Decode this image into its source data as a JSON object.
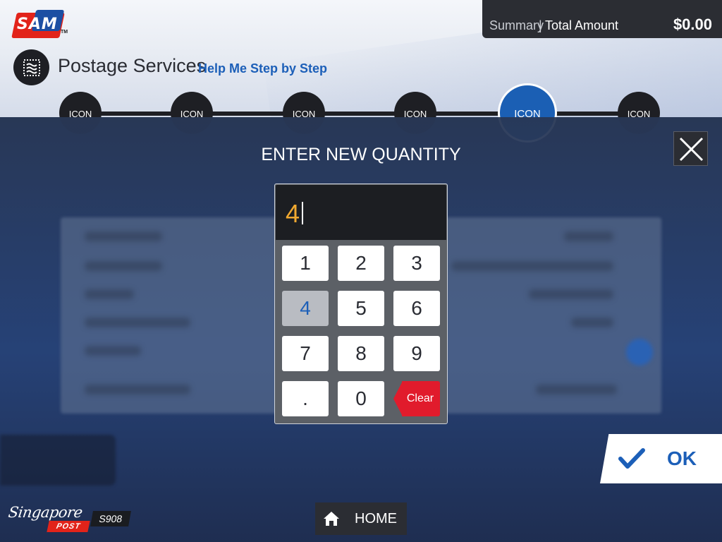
{
  "brand": {
    "logo_text": "SAM",
    "logo_tm": "TM"
  },
  "summary": {
    "label": "Summary",
    "separator": "|",
    "total_label": "Total Amount",
    "amount": "$0.00"
  },
  "service": {
    "icon": "stamp-icon",
    "title": "Postage Services",
    "help_link": "Help Me Step by Step"
  },
  "steps": [
    {
      "label": "ICON",
      "active": false
    },
    {
      "label": "ICON",
      "active": false
    },
    {
      "label": "ICON",
      "active": false
    },
    {
      "label": "ICON",
      "active": false
    },
    {
      "label": "ICON",
      "active": true
    },
    {
      "label": "ICON",
      "active": false
    }
  ],
  "modal": {
    "title": "ENTER NEW QUANTITY",
    "value": "4",
    "keys": [
      "1",
      "2",
      "3",
      "4",
      "5",
      "6",
      "7",
      "8",
      "9",
      ".",
      "0"
    ],
    "selected_key": "4",
    "clear_label": "Clear"
  },
  "ok": {
    "label": "OK",
    "icon": "checkmark-icon"
  },
  "footer": {
    "logo_script": "Singapore",
    "logo_post": "POST",
    "kiosk_id": "S908",
    "home_label": "HOME",
    "home_icon": "home-icon"
  },
  "colors": {
    "accent": "#1c5fb8",
    "brand_red": "#e2231a",
    "value_orange": "#f0a830",
    "dark": "#2b2d33"
  }
}
